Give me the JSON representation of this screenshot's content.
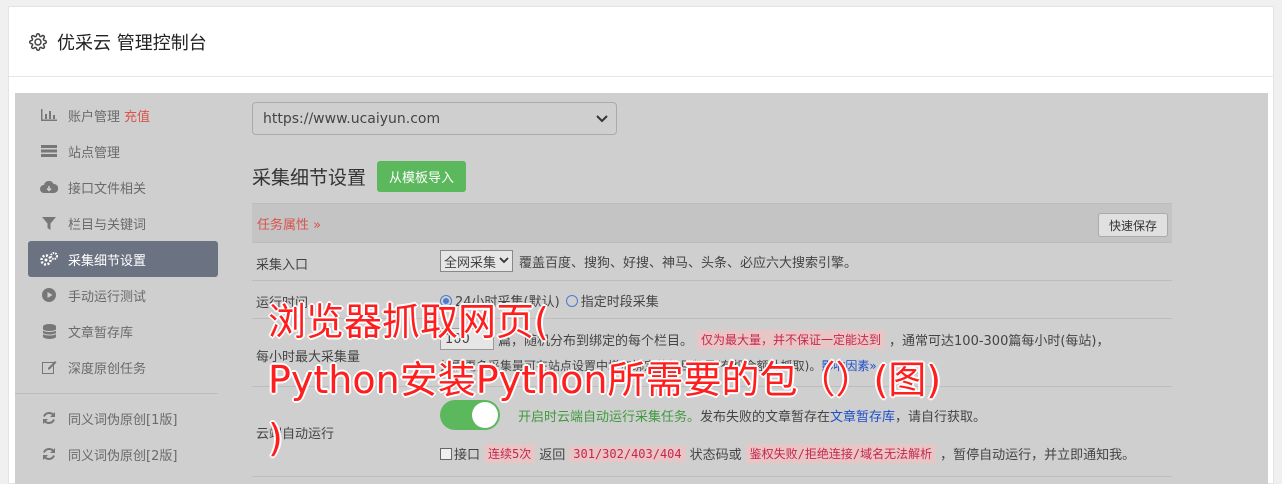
{
  "header": {
    "title": "优采云 管理控制台",
    "icon": "gear-icon"
  },
  "sidebar": {
    "items": [
      {
        "label": "账户管理",
        "extra": "充值",
        "icon": "bar-chart-icon"
      },
      {
        "label": "站点管理",
        "icon": "server-icon"
      },
      {
        "label": "接口文件相关",
        "icon": "cloud-download-icon"
      },
      {
        "label": "栏目与关键词",
        "icon": "filter-icon"
      },
      {
        "label": "采集细节设置",
        "icon": "cogs-icon",
        "active": true
      },
      {
        "label": "手动运行测试",
        "icon": "play-circle-icon"
      },
      {
        "label": "文章暂存库",
        "icon": "database-icon"
      },
      {
        "label": "深度原创任务",
        "icon": "edit-icon"
      }
    ],
    "items2": [
      {
        "label": "同义词伪原创[1版]",
        "icon": "refresh-icon"
      },
      {
        "label": "同义词伪原创[2版]",
        "icon": "refresh-icon"
      }
    ]
  },
  "main": {
    "site_select": "https://www.ucaiyun.com",
    "section_title": "采集细节设置",
    "import_button": "从模板导入",
    "task_props": "任务属性 »",
    "save_button": "快速保存",
    "rows": {
      "entry": {
        "label": "采集入口",
        "select": "全网采集",
        "desc": "覆盖百度、搜狗、好搜、神马、头条、必应六大搜索引擎。"
      },
      "runtime": {
        "label": "运行时间",
        "opt1": "24小时采集(默认)",
        "opt2": "指定时段采集"
      },
      "hourly": {
        "label": "每小时最大采集量",
        "value": "100",
        "text1": "篇，随机分布到绑定的每个栏目。",
        "pink": "仅为最大量，并不保证一定能达到",
        "text2": "，通常可达100-300篇每小时(每站)，",
        "text3": "如需更多采集量可在站点设置中增加绑定的栏目数量(有机会额外抓取)。",
        "link": "影响因素»"
      },
      "cloud": {
        "label": "云端自动运行",
        "green": "开启时云端自动运行采集任务。",
        "text1": "发布失败的文章暂存在",
        "link": "文章暂存库",
        "text2": "，请自行获取。",
        "chk_label": "接口",
        "pink1": "连续5次",
        "t1": "返回",
        "pink2": "301/302/403/404",
        "t2": "状态码或",
        "pink3": "鉴权失败/拒绝连接/域名无法解析",
        "t3": "，暂停自动运行，并立即通知我。"
      }
    }
  },
  "overlay": {
    "line1": "浏览器抓取网页(",
    "line2": "Python安装Python所需要的包（）(图)",
    "line3": ")"
  },
  "colors": {
    "accent_green": "#5cb85c",
    "danger": "#d9534f",
    "link": "#1d4ec9",
    "overlay_text": "#ff1d1d"
  }
}
